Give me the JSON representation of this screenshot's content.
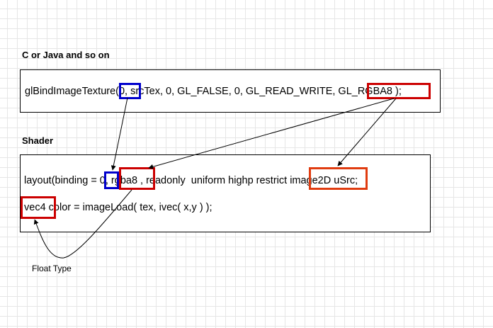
{
  "sections": {
    "host": {
      "heading": "C or Java and so on"
    },
    "shader": {
      "heading": "Shader"
    }
  },
  "host_code": {
    "line": "glBindImageTexture(0, srcTex, 0, GL_FALSE, 0, GL_READ_WRITE, GL_RGBA8 );"
  },
  "shader_code": {
    "line1": "layout(binding = 0, rgba8 , readonly  uniform highp restrict image2D uSrc;",
    "line2": "vec4 color = imageLoad( tex, ivec( x,y ) );"
  },
  "annotations": {
    "float_type": "Float Type"
  },
  "colors": {
    "binding_highlight": "#0000cc",
    "format_highlight": "#cc0000",
    "image_type_highlight": "#e03c10",
    "vec4_highlight": "#cc0000",
    "connector": "#000000"
  }
}
